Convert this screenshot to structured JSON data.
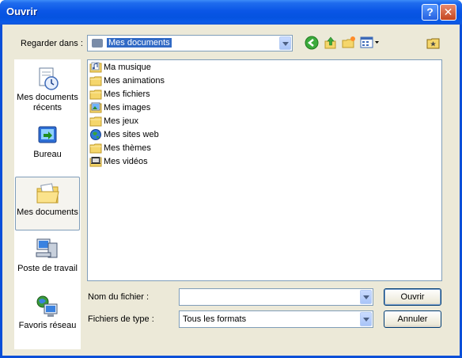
{
  "window": {
    "title": "Ouvrir"
  },
  "look_in": {
    "label": "Regarder dans :",
    "value": "Mes documents"
  },
  "toolbar_icons": [
    "back-icon",
    "up-folder-icon",
    "new-folder-icon",
    "views-menu-icon",
    "favorite-folder-icon"
  ],
  "places": [
    {
      "label": "Mes documents récents",
      "icon": "recent-documents-icon"
    },
    {
      "label": "Bureau",
      "icon": "desktop-icon"
    },
    {
      "label": "Mes documents",
      "icon": "my-documents-icon"
    },
    {
      "label": "Poste de travail",
      "icon": "my-computer-icon"
    },
    {
      "label": "Favoris réseau",
      "icon": "network-places-icon"
    }
  ],
  "files": [
    {
      "name": "Ma musique",
      "icon": "music-folder-icon"
    },
    {
      "name": "Mes animations",
      "icon": "folder-icon"
    },
    {
      "name": "Mes fichiers",
      "icon": "folder-icon"
    },
    {
      "name": "Mes images",
      "icon": "pictures-folder-icon"
    },
    {
      "name": "Mes jeux",
      "icon": "folder-icon"
    },
    {
      "name": "Mes sites web",
      "icon": "web-folder-icon"
    },
    {
      "name": "Mes thèmes",
      "icon": "folder-icon"
    },
    {
      "name": "Mes vidéos",
      "icon": "video-folder-icon"
    }
  ],
  "filename": {
    "label": "Nom du fichier :",
    "value": ""
  },
  "filetype": {
    "label": "Fichiers de type :",
    "value": "Tous les formats"
  },
  "buttons": {
    "open": "Ouvrir",
    "cancel": "Annuler"
  },
  "colors": {
    "title_bar": "#0a56e6",
    "dialog_bg": "#ece9d8",
    "selection": "#316ac5",
    "folder": "#f5d66b"
  }
}
